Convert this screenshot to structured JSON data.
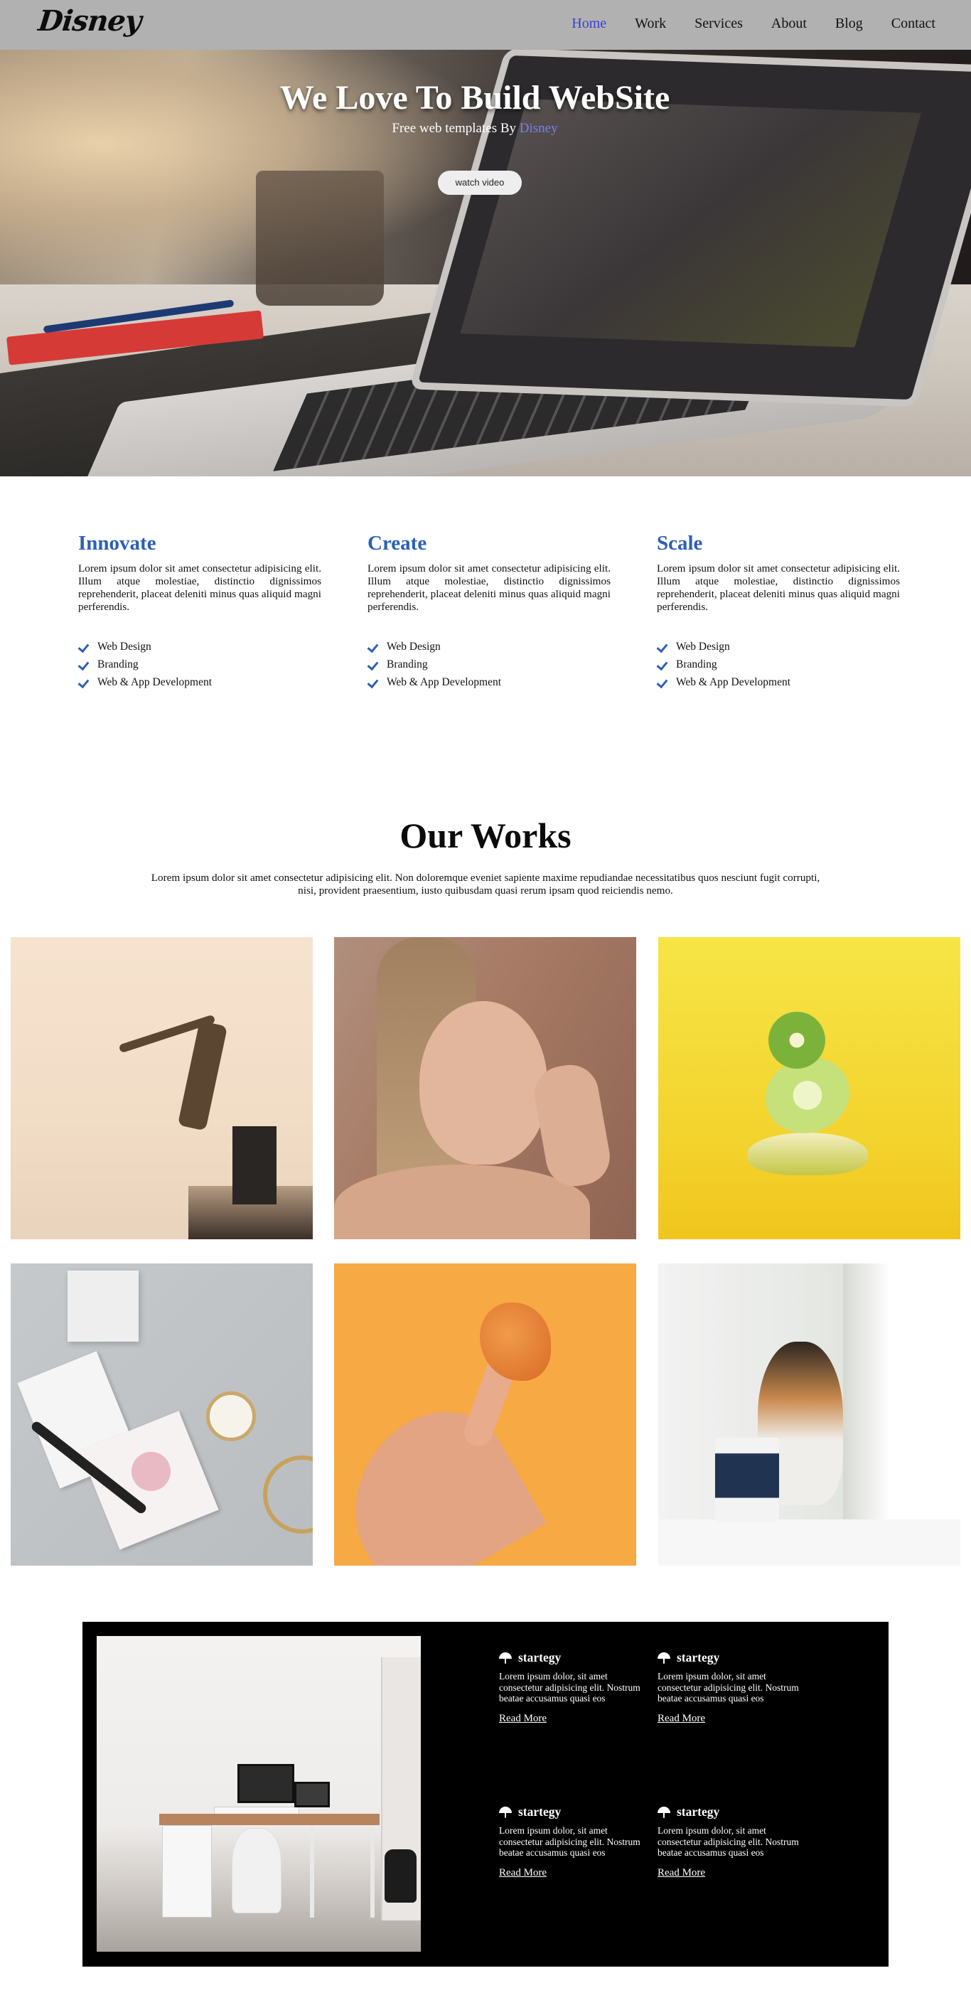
{
  "nav": {
    "logo": "Disney",
    "links": [
      "Home",
      "Work",
      "Services",
      "About",
      "Blog",
      "Contact"
    ],
    "active_color": "#3a3fd6"
  },
  "hero": {
    "title": "We Love To Build WebSite",
    "subtitle_prefix": "Free web templates By ",
    "subtitle_brand": "Disney",
    "button": "watch video"
  },
  "features": [
    {
      "title": "Innovate",
      "text": "Lorem ipsum dolor sit amet consectetur adipisicing elit. Illum atque molestiae, distinctio dignissimos reprehenderit, placeat deleniti minus quas aliquid magni perferendis.",
      "items": [
        "Web Design",
        "Branding",
        "Web & App Development"
      ]
    },
    {
      "title": "Create",
      "text": "Lorem ipsum dolor sit amet consectetur adipisicing elit. Illum atque molestiae, distinctio dignissimos reprehenderit, placeat deleniti minus quas aliquid magni perferendis.",
      "items": [
        "Web Design",
        "Branding",
        "Web & App Development"
      ]
    },
    {
      "title": "Scale",
      "text": "Lorem ipsum dolor sit amet consectetur adipisicing elit. Illum atque molestiae, distinctio dignissimos reprehenderit, placeat deleniti minus quas aliquid magni perferendis.",
      "items": [
        "Web Design",
        "Branding",
        "Web & App Development"
      ]
    }
  ],
  "works": {
    "title": "Our Works",
    "text": "Lorem ipsum dolor sit amet consectetur adipisicing elit. Non doloremque eveniet sapiente maxime repudiandae necessitatibus quos nesciunt fugit corrupti, nisi, provident praesentium, iusto quibusdam quasi rerum ipsam quod reiciendis nemo.",
    "images": [
      "bonsai-tree-image",
      "woman-portrait-image",
      "kiwi-lime-pear-image",
      "desk-flatlay-watch-image",
      "hand-nugget-image",
      "cat-window-image"
    ]
  },
  "strategy": {
    "blocks": [
      {
        "title": "startegy",
        "text": "Lorem ipsum dolor, sit amet consectetur adipisicing elit. Nostrum beatae accusamus quasi eos",
        "link": "Read More"
      },
      {
        "title": "startegy",
        "text": "Lorem ipsum dolor, sit amet consectetur adipisicing elit. Nostrum beatae accusamus quasi eos",
        "link": "Read More"
      },
      {
        "title": "startegy",
        "text": "Lorem ipsum dolor, sit amet consectetur adipisicing elit. Nostrum beatae accusamus quasi eos",
        "link": "Read More"
      },
      {
        "title": "startegy",
        "text": "Lorem ipsum dolor, sit amet consectetur adipisicing elit. Nostrum beatae accusamus quasi eos",
        "link": "Read More"
      }
    ]
  },
  "colors": {
    "nav_bg": "#b1b1b1",
    "feature_title": "#2c5fb8",
    "footer_bg": "#000000"
  }
}
